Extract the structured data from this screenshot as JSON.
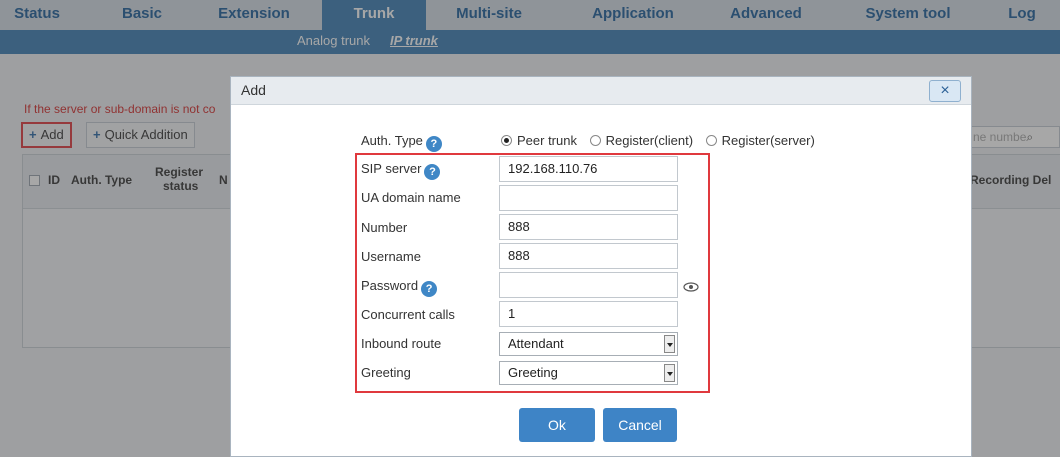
{
  "nav": {
    "tabs": [
      "Status",
      "Basic",
      "Extension",
      "Trunk",
      "Multi-site",
      "Application",
      "Advanced",
      "System tool",
      "Log"
    ],
    "active": "Trunk",
    "sub_tabs": [
      "Analog trunk",
      "IP trunk"
    ],
    "sub_active": "IP trunk"
  },
  "page": {
    "warning_text": "If the server or sub-domain is not co",
    "add_label": "Add",
    "quick_add_label": "Quick Addition",
    "search_placeholder": "ne numbe",
    "columns": {
      "id": "ID",
      "auth_type": "Auth. Type",
      "register_status_1": "Register",
      "register_status_2": "status",
      "n_fragment": "N",
      "recording": "Recording Del"
    }
  },
  "dialog": {
    "title": "Add",
    "close_symbol": "×",
    "auth_type_label": "Auth. Type",
    "auth_options": [
      "Peer trunk",
      "Register(client)",
      "Register(server)"
    ],
    "auth_selected": "Peer trunk",
    "fields": {
      "sip_server": {
        "label": "SIP server",
        "value": "192.168.110.76"
      },
      "ua_domain": {
        "label": "UA domain name",
        "value": ""
      },
      "number": {
        "label": "Number",
        "value": "888"
      },
      "username": {
        "label": "Username",
        "value": "888"
      },
      "password": {
        "label": "Password",
        "value": ""
      },
      "concurrent_calls": {
        "label": "Concurrent calls",
        "value": "1"
      },
      "inbound_route": {
        "label": "Inbound route",
        "value": "Attendant"
      },
      "greeting": {
        "label": "Greeting",
        "value": "Greeting"
      }
    },
    "ok_label": "Ok",
    "cancel_label": "Cancel"
  },
  "colors": {
    "accent": "#3c7fb5",
    "highlight": "#e0393e",
    "warning": "#d62b2b"
  },
  "icons": [
    "help-icon",
    "eye-icon",
    "search-icon",
    "plus-icon",
    "close-icon",
    "chevron-down-icon"
  ]
}
